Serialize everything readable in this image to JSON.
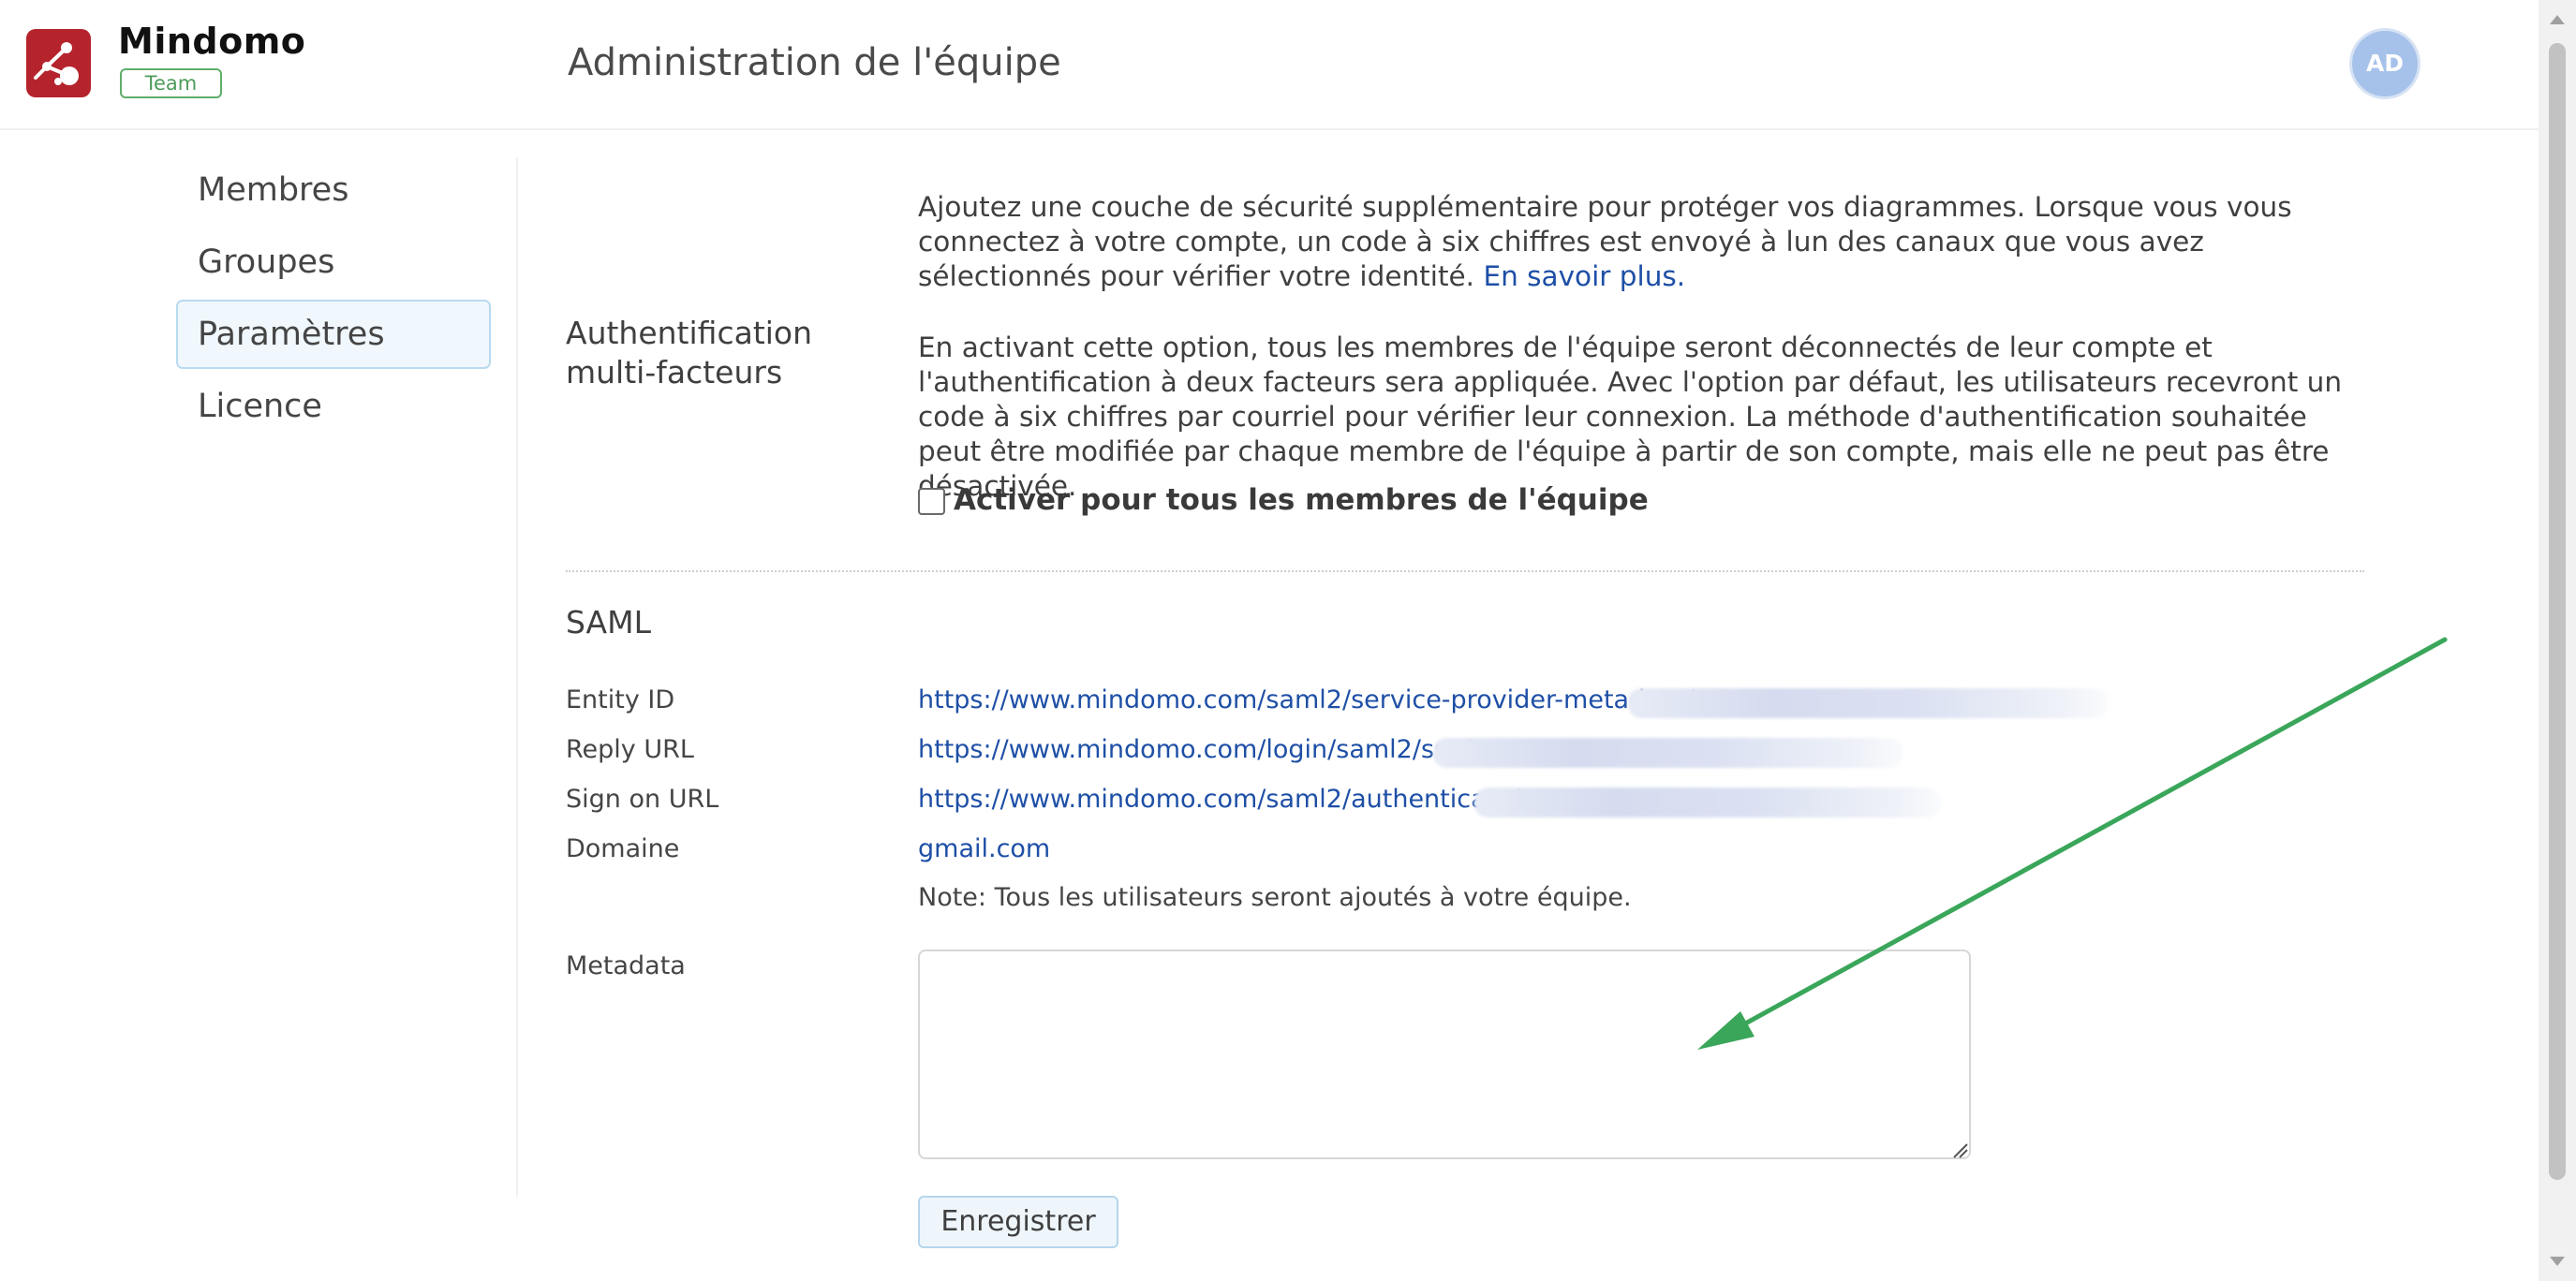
{
  "header": {
    "brand_name": "Mindomo",
    "plan_badge": "Team",
    "page_title": "Administration de l'équipe",
    "avatar_initials": "AD"
  },
  "sidebar": {
    "items": [
      {
        "label": "Membres",
        "active": false
      },
      {
        "label": "Groupes",
        "active": false
      },
      {
        "label": "Paramètres",
        "active": true
      },
      {
        "label": "Licence",
        "active": false
      }
    ]
  },
  "mfa": {
    "title_line1": "Authentification",
    "title_line2": "multi-facteurs",
    "intro_text": "Ajoutez une couche de sécurité supplémentaire pour protéger vos diagrammes. Lorsque vous vous connectez à votre compte, un code à six chiffres est envoyé à lun des canaux que vous avez sélectionnés pour vérifier votre identité.",
    "learn_more_link": "En savoir plus.",
    "detail_text": "En activant cette option, tous les membres de l'équipe seront déconnectés de leur compte et l'authentification à deux facteurs sera appliquée. Avec l'option par défaut, les utilisateurs recevront un code à six chiffres par courriel pour vérifier leur connexion. La méthode d'authentification souhaitée peut être modifiée par chaque membre de l'équipe à partir de son compte, mais elle ne peut pas être désactivée.",
    "checkbox_label": "Activer pour tous les membres de l'équipe",
    "checkbox_checked": false
  },
  "saml": {
    "title": "SAML",
    "entity_id_label": "Entity ID",
    "entity_id_value": "https://www.mindomo.com/saml2/service-provider-metadata/",
    "reply_url_label": "Reply URL",
    "reply_url_value": "https://www.mindomo.com/login/saml2/sso/",
    "sign_on_url_label": "Sign on URL",
    "sign_on_url_value": "https://www.mindomo.com/saml2/authenticate/",
    "domain_label": "Domaine",
    "domain_value": "gmail.com",
    "note": "Note: Tous les utilisateurs seront ajoutés à votre équipe.",
    "metadata_label": "Metadata",
    "metadata_value": "",
    "save_label": "Enregistrer"
  },
  "colors": {
    "brand_red": "#b5232c",
    "link_blue": "#1e4fa6",
    "annotation_green": "#3aa65a"
  }
}
